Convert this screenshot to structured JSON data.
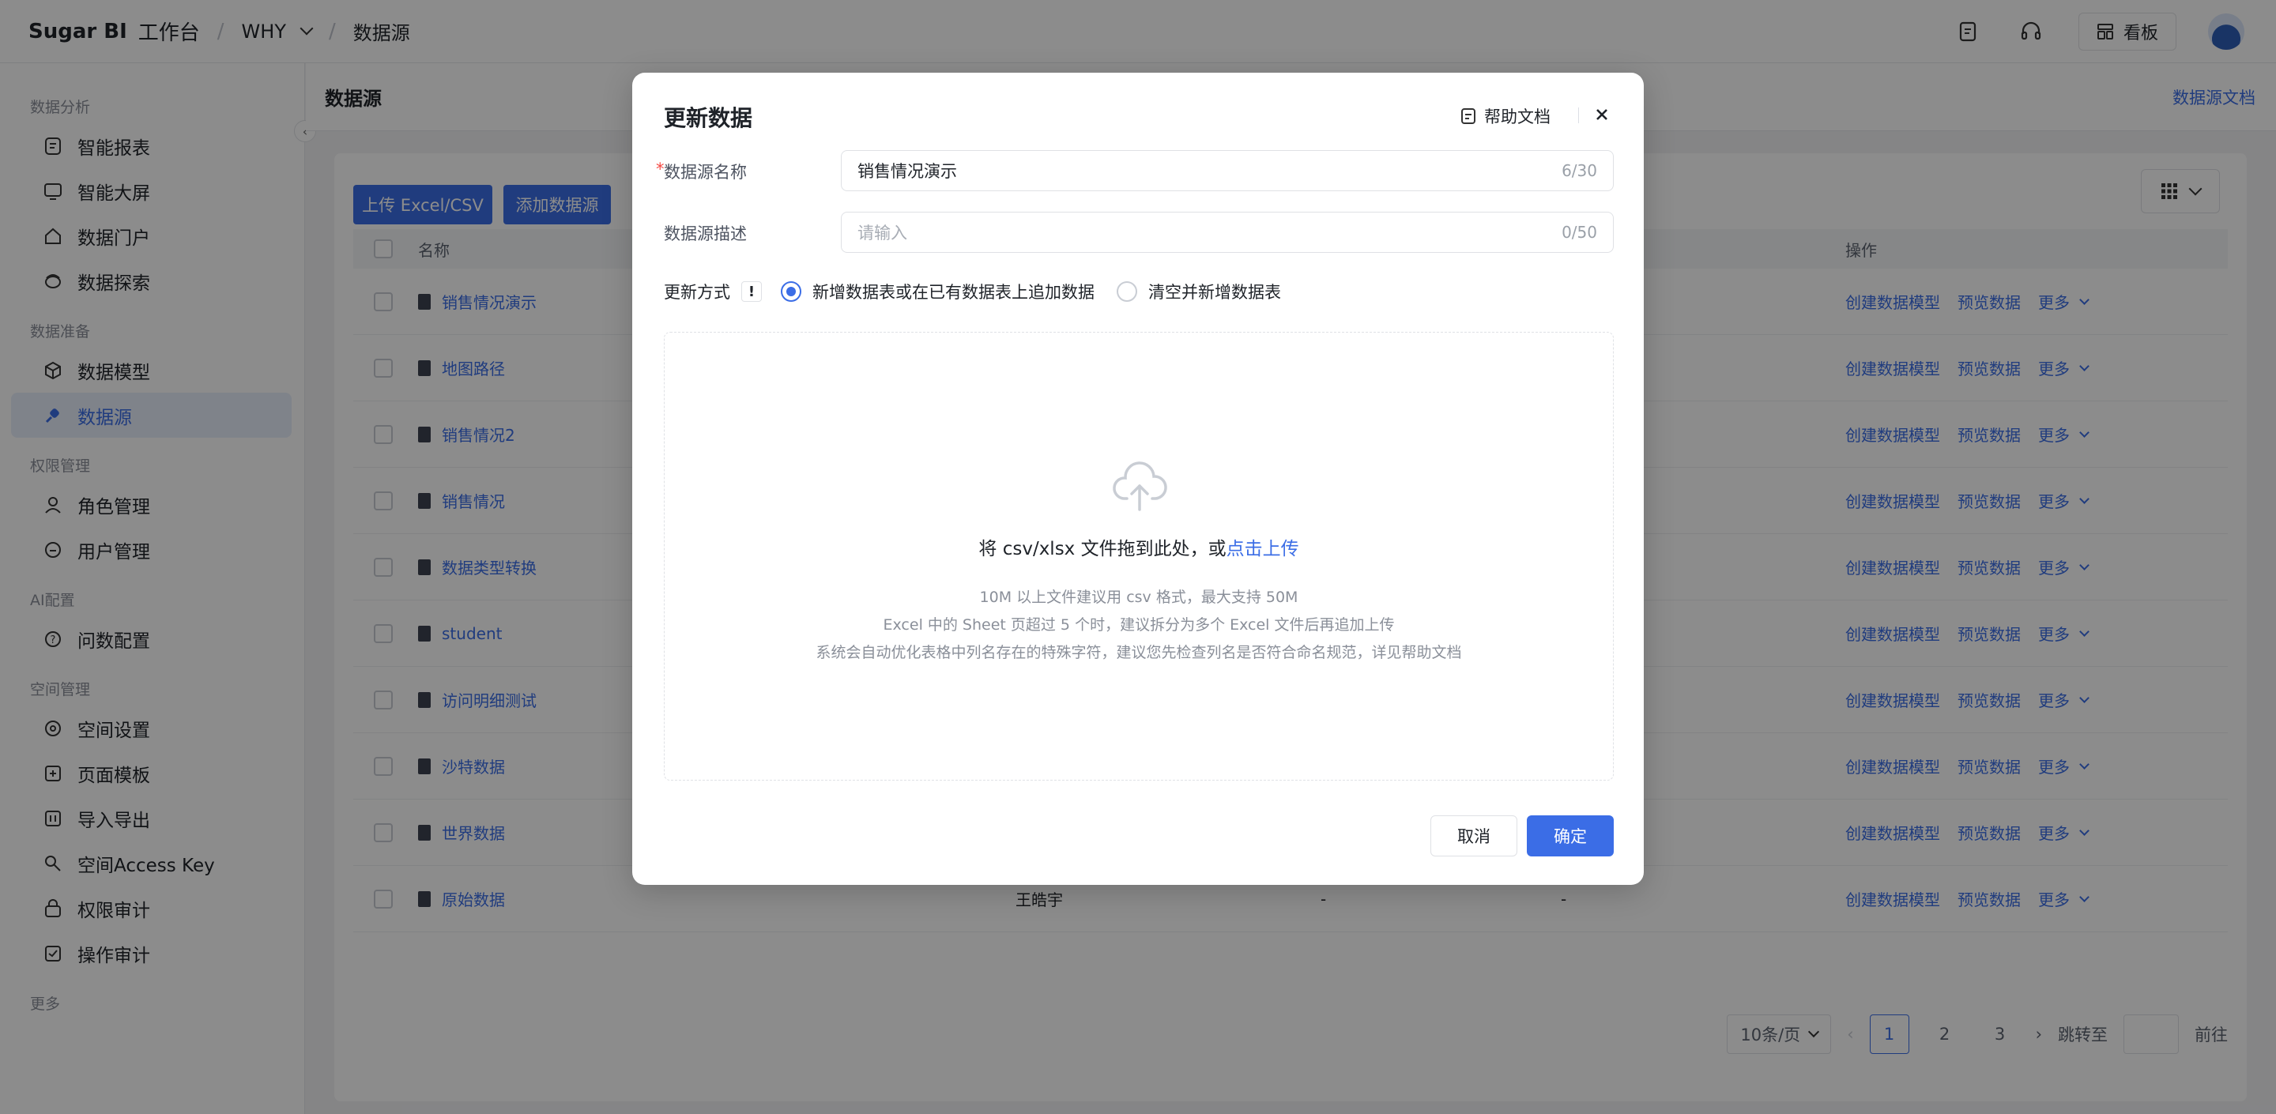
{
  "topbar": {
    "brand": "Sugar BI",
    "workspace_label": "工作台",
    "space": "WHY",
    "page": "数据源",
    "kanban_label": "看板"
  },
  "sidebar": {
    "groups": [
      {
        "title": "数据分析",
        "items": [
          {
            "label": "智能报表",
            "icon": "report-icon"
          },
          {
            "label": "智能大屏",
            "icon": "screen-icon"
          },
          {
            "label": "数据门户",
            "icon": "home-icon"
          },
          {
            "label": "数据探索",
            "icon": "explore-icon"
          }
        ]
      },
      {
        "title": "数据准备",
        "items": [
          {
            "label": "数据模型",
            "icon": "cube-icon"
          },
          {
            "label": "数据源",
            "icon": "link-icon",
            "active": true
          }
        ]
      },
      {
        "title": "权限管理",
        "items": [
          {
            "label": "角色管理",
            "icon": "user-icon"
          },
          {
            "label": "用户管理",
            "icon": "users-icon"
          }
        ]
      },
      {
        "title": "AI配置",
        "items": [
          {
            "label": "问数配置",
            "icon": "question-icon"
          }
        ]
      },
      {
        "title": "空间管理",
        "items": [
          {
            "label": "空间设置",
            "icon": "settings-icon"
          },
          {
            "label": "页面模板",
            "icon": "template-icon"
          },
          {
            "label": "导入导出",
            "icon": "import-export-icon"
          },
          {
            "label": "空间Access Key",
            "icon": "key-icon"
          },
          {
            "label": "权限审计",
            "icon": "lock-icon"
          },
          {
            "label": "操作审计",
            "icon": "audit-icon"
          }
        ]
      }
    ],
    "more_label": "更多"
  },
  "main": {
    "title": "数据源",
    "doc_link": "数据源文档",
    "upload_btn": "上传 Excel/CSV",
    "add_btn": "添加数据源",
    "table": {
      "col_name": "名称",
      "col_ops": "操作",
      "rows": [
        {
          "name": "销售情况演示"
        },
        {
          "name": "地图路径"
        },
        {
          "name": "销售情况2"
        },
        {
          "name": "销售情况"
        },
        {
          "name": "数据类型转换"
        },
        {
          "name": "student"
        },
        {
          "name": "访问明细测试"
        },
        {
          "name": "沙特数据"
        },
        {
          "name": "世界数据"
        },
        {
          "name": "原始数据",
          "creator": "王皓宇",
          "c3": "-",
          "c4": "-"
        }
      ],
      "op_create": "创建数据模型",
      "op_preview": "预览数据",
      "op_more": "更多"
    },
    "pager": {
      "page_size": "10条/页",
      "pages": [
        "1",
        "2",
        "3"
      ],
      "jump_label": "跳转至",
      "go_label": "前往"
    }
  },
  "modal": {
    "title": "更新数据",
    "help_label": "帮助文档",
    "name_label": "数据源名称",
    "name_value": "销售情况演示",
    "name_count": "6/30",
    "desc_label": "数据源描述",
    "desc_placeholder": "请输入",
    "desc_count": "0/50",
    "mode_label": "更新方式",
    "mode_warn": "!",
    "option_append": "新增数据表或在已有数据表上追加数据",
    "option_clear": "清空并新增数据表",
    "drop_text": "将 csv/xlsx 文件拖到此处，或",
    "drop_link": "点击上传",
    "hint1": "10M 以上文件建议用 csv 格式，最大支持 50M",
    "hint2": "Excel 中的 Sheet 页超过 5 个时，建议拆分为多个 Excel 文件后再追加上传",
    "hint3": "系统会自动优化表格中列名存在的特殊字符，建议您先检查列名是否符合命名规范，详见帮助文档",
    "cancel": "取消",
    "ok": "确定"
  }
}
